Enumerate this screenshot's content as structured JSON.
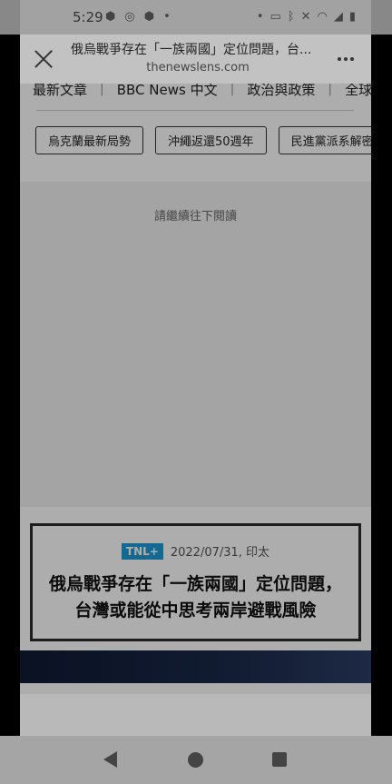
{
  "status_bar": {
    "time": "5:29",
    "icons_left": [
      "android-icon",
      "sync-icon",
      "android-icon",
      "dot-icon"
    ],
    "icons_right": [
      "dot-icon",
      "cast-icon",
      "bluetooth-icon",
      "mute-icon",
      "wifi-icon",
      "signal-icon",
      "battery-icon"
    ]
  },
  "toolbar": {
    "page_title": "俄烏戰爭存在「一族兩國」定位問題，台...",
    "domain": "thenewslens.com"
  },
  "nav_tabs": [
    "最新文章",
    "BBC News 中文",
    "政治與政策",
    "全球動"
  ],
  "topic_chips": [
    "烏克蘭最新局勢",
    "沖繩返還50週年",
    "民進黨派系解密"
  ],
  "read_more": "請繼續往下閱讀",
  "article_card": {
    "badge": "TNL+",
    "meta": "2022/07/31, 印太",
    "title": "俄烏戰爭存在「一族兩國」定位問題，台灣或能從中思考兩岸避戰風險"
  },
  "colors": {
    "badge": "#1e9bd7",
    "scrim": "rgba(0,0,0,0.32)"
  }
}
